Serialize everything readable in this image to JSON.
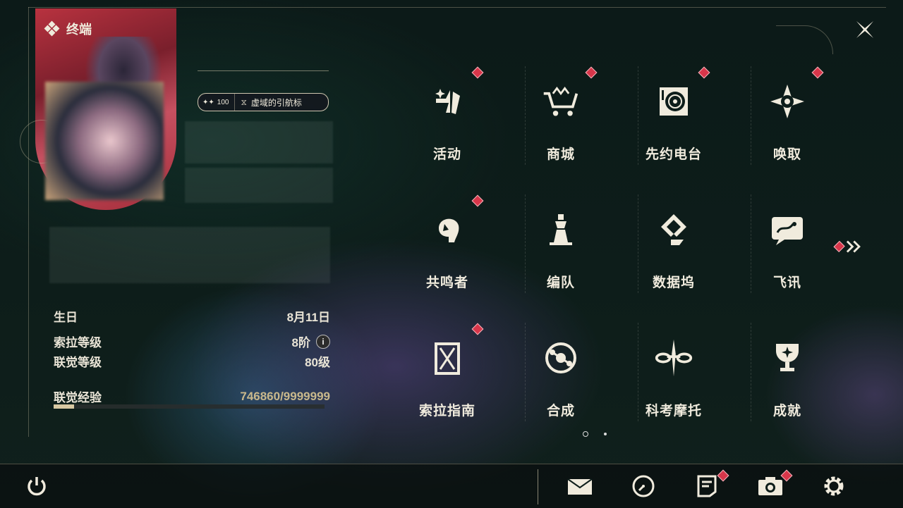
{
  "header": {
    "title": "终端"
  },
  "profile": {
    "badge_count": "100",
    "badge_title": "虚域的引航标"
  },
  "stats": {
    "birthday_label": "生日",
    "birthday_value": "8月11日",
    "sora_level_label": "索拉等级",
    "sora_level_value": "8阶",
    "union_level_label": "联觉等级",
    "union_level_value": "80级",
    "union_exp_label": "联觉经验",
    "union_exp_value": "746860/9999999",
    "union_exp_current": 746860,
    "union_exp_max": 9999999
  },
  "menu": {
    "items": [
      {
        "label": "活动",
        "icon": "events-icon",
        "notify": true
      },
      {
        "label": "商城",
        "icon": "shop-cart-icon",
        "notify": true
      },
      {
        "label": "先约电台",
        "icon": "radio-icon",
        "notify": true
      },
      {
        "label": "唤取",
        "icon": "convene-icon",
        "notify": true
      },
      {
        "label": "共鸣者",
        "icon": "resonator-icon",
        "notify": true
      },
      {
        "label": "编队",
        "icon": "team-chess-icon",
        "notify": false
      },
      {
        "label": "数据坞",
        "icon": "data-bank-icon",
        "notify": false
      },
      {
        "label": "飞讯",
        "icon": "message-icon",
        "notify": false
      },
      {
        "label": "索拉指南",
        "icon": "guidebook-icon",
        "notify": true
      },
      {
        "label": "合成",
        "icon": "synthesis-icon",
        "notify": false
      },
      {
        "label": "科考摩托",
        "icon": "motorcycle-icon",
        "notify": false
      },
      {
        "label": "成就",
        "icon": "trophy-icon",
        "notify": false
      }
    ],
    "page_current": 1,
    "page_total": 2
  },
  "bottom_bar": [
    "power-icon",
    "mail-icon",
    "clock-icon",
    "notice-icon",
    "camera-icon",
    "settings-gear-icon"
  ],
  "colors": {
    "accent_red": "#d8364a",
    "text": "#f0ebdd",
    "exp_text": "#c9b88c",
    "exp_fill": "#d8c9a3"
  }
}
